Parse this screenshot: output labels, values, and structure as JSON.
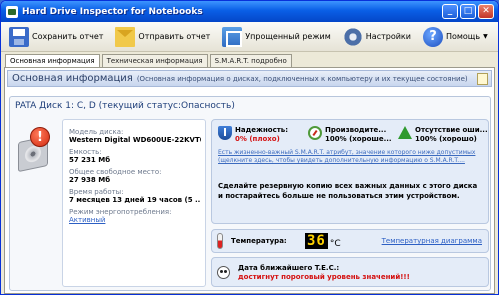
{
  "window": {
    "title": "Hard Drive Inspector for Notebooks",
    "min_label": "_",
    "max_label": "□",
    "close_label": "✕"
  },
  "toolbar": {
    "save_label": "Сохранить отчет",
    "send_label": "Отправить отчет",
    "simple_label": "Упрощенный режим",
    "settings_label": "Настройки",
    "help_label": "Помощь",
    "help_caret": "▼",
    "help_glyph": "?"
  },
  "tabs": [
    {
      "label": "Основная информация"
    },
    {
      "label": "Техническая информация"
    },
    {
      "label": "S.M.A.R.T. подробно"
    }
  ],
  "section": {
    "title": "Основная информация",
    "subtitle": "(Основная информация о дисках, подключенных к компьютеру и их текущее состояние)"
  },
  "disk": {
    "title": "PATA Диск 1: C, D (текущий статус:Опасность)",
    "badge": "!",
    "model_label": "Модель диска:",
    "model_value": "Western Digital WD600UE-22KVT0",
    "capacity_label": "Емкость:",
    "capacity_value": "57 231 Мб",
    "free_label": "Общее свободное место:",
    "free_value": "27 938 Мб",
    "uptime_label": "Время работы:",
    "uptime_value": "7 месяцев 13 дней 19 часов (5 ...",
    "power_label": "Режим энергопотребления:",
    "power_value": "Активный"
  },
  "status": {
    "reliability_label": "Надежность:",
    "reliability_value": "0% (плохо)",
    "performance_label": "Производите...",
    "performance_value": "100% (хороше...",
    "errors_label": "Отсутствие оши...",
    "errors_value": "100% (хорошо)",
    "note": "Есть жизненно-важный S.M.A.R.T. атрибут, значение которого ниже допустимых (щелкните здесь, чтобы увидеть дополнительную информацию о S.M.A.R.T....",
    "advice": "Сделайте резервную копию всех важных данных с этого диска и постарайтесь больше не пользоваться этим устройством."
  },
  "temperature": {
    "label": "Температура:",
    "value": "36",
    "unit": "°C",
    "link": "Температурная диаграмма"
  },
  "tec": {
    "label": "Дата ближайшего T.E.C.:",
    "value": "достигнут пороговый уровень значений!!!"
  },
  "colors": {
    "titlebar": "#0a5fe6",
    "danger": "#d41010",
    "link": "#2c5fc4",
    "lcd_digits": "#ffd200"
  }
}
